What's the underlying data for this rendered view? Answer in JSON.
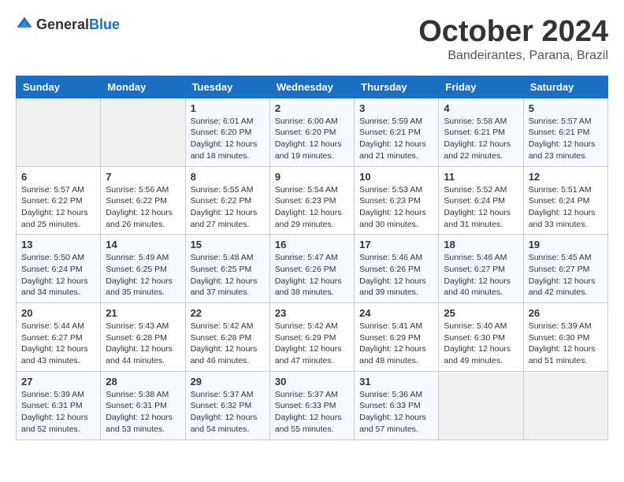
{
  "header": {
    "logo_general": "General",
    "logo_blue": "Blue",
    "month": "October 2024",
    "location": "Bandeirantes, Parana, Brazil"
  },
  "weekdays": [
    "Sunday",
    "Monday",
    "Tuesday",
    "Wednesday",
    "Thursday",
    "Friday",
    "Saturday"
  ],
  "weeks": [
    [
      {
        "day": "",
        "sunrise": "",
        "sunset": "",
        "daylight": ""
      },
      {
        "day": "",
        "sunrise": "",
        "sunset": "",
        "daylight": ""
      },
      {
        "day": "1",
        "sunrise": "Sunrise: 6:01 AM",
        "sunset": "Sunset: 6:20 PM",
        "daylight": "Daylight: 12 hours and 18 minutes."
      },
      {
        "day": "2",
        "sunrise": "Sunrise: 6:00 AM",
        "sunset": "Sunset: 6:20 PM",
        "daylight": "Daylight: 12 hours and 19 minutes."
      },
      {
        "day": "3",
        "sunrise": "Sunrise: 5:59 AM",
        "sunset": "Sunset: 6:21 PM",
        "daylight": "Daylight: 12 hours and 21 minutes."
      },
      {
        "day": "4",
        "sunrise": "Sunrise: 5:58 AM",
        "sunset": "Sunset: 6:21 PM",
        "daylight": "Daylight: 12 hours and 22 minutes."
      },
      {
        "day": "5",
        "sunrise": "Sunrise: 5:57 AM",
        "sunset": "Sunset: 6:21 PM",
        "daylight": "Daylight: 12 hours and 23 minutes."
      }
    ],
    [
      {
        "day": "6",
        "sunrise": "Sunrise: 5:57 AM",
        "sunset": "Sunset: 6:22 PM",
        "daylight": "Daylight: 12 hours and 25 minutes."
      },
      {
        "day": "7",
        "sunrise": "Sunrise: 5:56 AM",
        "sunset": "Sunset: 6:22 PM",
        "daylight": "Daylight: 12 hours and 26 minutes."
      },
      {
        "day": "8",
        "sunrise": "Sunrise: 5:55 AM",
        "sunset": "Sunset: 6:22 PM",
        "daylight": "Daylight: 12 hours and 27 minutes."
      },
      {
        "day": "9",
        "sunrise": "Sunrise: 5:54 AM",
        "sunset": "Sunset: 6:23 PM",
        "daylight": "Daylight: 12 hours and 29 minutes."
      },
      {
        "day": "10",
        "sunrise": "Sunrise: 5:53 AM",
        "sunset": "Sunset: 6:23 PM",
        "daylight": "Daylight: 12 hours and 30 minutes."
      },
      {
        "day": "11",
        "sunrise": "Sunrise: 5:52 AM",
        "sunset": "Sunset: 6:24 PM",
        "daylight": "Daylight: 12 hours and 31 minutes."
      },
      {
        "day": "12",
        "sunrise": "Sunrise: 5:51 AM",
        "sunset": "Sunset: 6:24 PM",
        "daylight": "Daylight: 12 hours and 33 minutes."
      }
    ],
    [
      {
        "day": "13",
        "sunrise": "Sunrise: 5:50 AM",
        "sunset": "Sunset: 6:24 PM",
        "daylight": "Daylight: 12 hours and 34 minutes."
      },
      {
        "day": "14",
        "sunrise": "Sunrise: 5:49 AM",
        "sunset": "Sunset: 6:25 PM",
        "daylight": "Daylight: 12 hours and 35 minutes."
      },
      {
        "day": "15",
        "sunrise": "Sunrise: 5:48 AM",
        "sunset": "Sunset: 6:25 PM",
        "daylight": "Daylight: 12 hours and 37 minutes."
      },
      {
        "day": "16",
        "sunrise": "Sunrise: 5:47 AM",
        "sunset": "Sunset: 6:26 PM",
        "daylight": "Daylight: 12 hours and 38 minutes."
      },
      {
        "day": "17",
        "sunrise": "Sunrise: 5:46 AM",
        "sunset": "Sunset: 6:26 PM",
        "daylight": "Daylight: 12 hours and 39 minutes."
      },
      {
        "day": "18",
        "sunrise": "Sunrise: 5:46 AM",
        "sunset": "Sunset: 6:27 PM",
        "daylight": "Daylight: 12 hours and 40 minutes."
      },
      {
        "day": "19",
        "sunrise": "Sunrise: 5:45 AM",
        "sunset": "Sunset: 6:27 PM",
        "daylight": "Daylight: 12 hours and 42 minutes."
      }
    ],
    [
      {
        "day": "20",
        "sunrise": "Sunrise: 5:44 AM",
        "sunset": "Sunset: 6:27 PM",
        "daylight": "Daylight: 12 hours and 43 minutes."
      },
      {
        "day": "21",
        "sunrise": "Sunrise: 5:43 AM",
        "sunset": "Sunset: 6:28 PM",
        "daylight": "Daylight: 12 hours and 44 minutes."
      },
      {
        "day": "22",
        "sunrise": "Sunrise: 5:42 AM",
        "sunset": "Sunset: 6:28 PM",
        "daylight": "Daylight: 12 hours and 46 minutes."
      },
      {
        "day": "23",
        "sunrise": "Sunrise: 5:42 AM",
        "sunset": "Sunset: 6:29 PM",
        "daylight": "Daylight: 12 hours and 47 minutes."
      },
      {
        "day": "24",
        "sunrise": "Sunrise: 5:41 AM",
        "sunset": "Sunset: 6:29 PM",
        "daylight": "Daylight: 12 hours and 48 minutes."
      },
      {
        "day": "25",
        "sunrise": "Sunrise: 5:40 AM",
        "sunset": "Sunset: 6:30 PM",
        "daylight": "Daylight: 12 hours and 49 minutes."
      },
      {
        "day": "26",
        "sunrise": "Sunrise: 5:39 AM",
        "sunset": "Sunset: 6:30 PM",
        "daylight": "Daylight: 12 hours and 51 minutes."
      }
    ],
    [
      {
        "day": "27",
        "sunrise": "Sunrise: 5:39 AM",
        "sunset": "Sunset: 6:31 PM",
        "daylight": "Daylight: 12 hours and 52 minutes."
      },
      {
        "day": "28",
        "sunrise": "Sunrise: 5:38 AM",
        "sunset": "Sunset: 6:31 PM",
        "daylight": "Daylight: 12 hours and 53 minutes."
      },
      {
        "day": "29",
        "sunrise": "Sunrise: 5:37 AM",
        "sunset": "Sunset: 6:32 PM",
        "daylight": "Daylight: 12 hours and 54 minutes."
      },
      {
        "day": "30",
        "sunrise": "Sunrise: 5:37 AM",
        "sunset": "Sunset: 6:33 PM",
        "daylight": "Daylight: 12 hours and 55 minutes."
      },
      {
        "day": "31",
        "sunrise": "Sunrise: 5:36 AM",
        "sunset": "Sunset: 6:33 PM",
        "daylight": "Daylight: 12 hours and 57 minutes."
      },
      {
        "day": "",
        "sunrise": "",
        "sunset": "",
        "daylight": ""
      },
      {
        "day": "",
        "sunrise": "",
        "sunset": "",
        "daylight": ""
      }
    ]
  ]
}
